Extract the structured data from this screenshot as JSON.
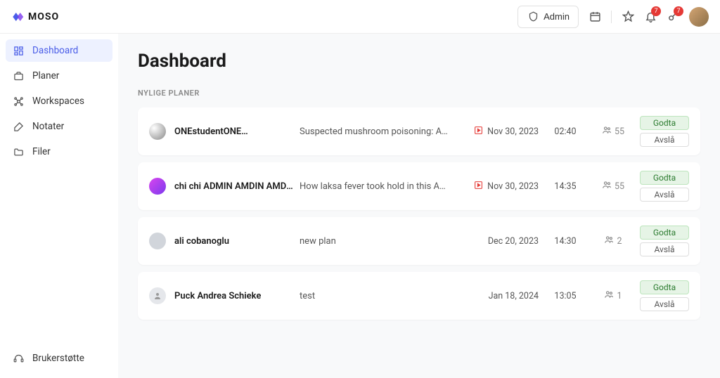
{
  "header": {
    "brand": "MOSO",
    "admin_label": "Admin",
    "notification_count": "7",
    "key_count": "7"
  },
  "sidebar": {
    "items": [
      {
        "label": "Dashboard",
        "icon": "dashboard"
      },
      {
        "label": "Planer",
        "icon": "briefcase"
      },
      {
        "label": "Workspaces",
        "icon": "workspace"
      },
      {
        "label": "Notater",
        "icon": "note"
      },
      {
        "label": "Filer",
        "icon": "folder"
      }
    ],
    "footer": {
      "label": "Brukerstøtte",
      "icon": "headset"
    }
  },
  "page": {
    "title": "Dashboard",
    "section_label": "NYLIGE PLANER",
    "accept_label": "Godta",
    "reject_label": "Avslå"
  },
  "plans": [
    {
      "name": "ONEstudentONE…",
      "desc": "Suspected mushroom poisoning: Australian woman…",
      "date": "Nov 30, 2023",
      "time": "02:40",
      "count": "55",
      "flagged": true,
      "avatar_class": "av1"
    },
    {
      "name": "chi chi ADMIN AMDIN AMDIN",
      "desc": "How laksa fever took hold in this Australian city How…",
      "date": "Nov 30, 2023",
      "time": "14:35",
      "count": "55",
      "flagged": true,
      "avatar_class": "av2"
    },
    {
      "name": "ali cobanoglu",
      "desc": "new plan",
      "date": "Dec 20, 2023",
      "time": "14:30",
      "count": "2",
      "flagged": false,
      "avatar_class": "av3"
    },
    {
      "name": "Puck Andrea Schieke",
      "desc": "test",
      "date": "Jan 18, 2024",
      "time": "13:05",
      "count": "1",
      "flagged": false,
      "avatar_class": "av4"
    }
  ]
}
